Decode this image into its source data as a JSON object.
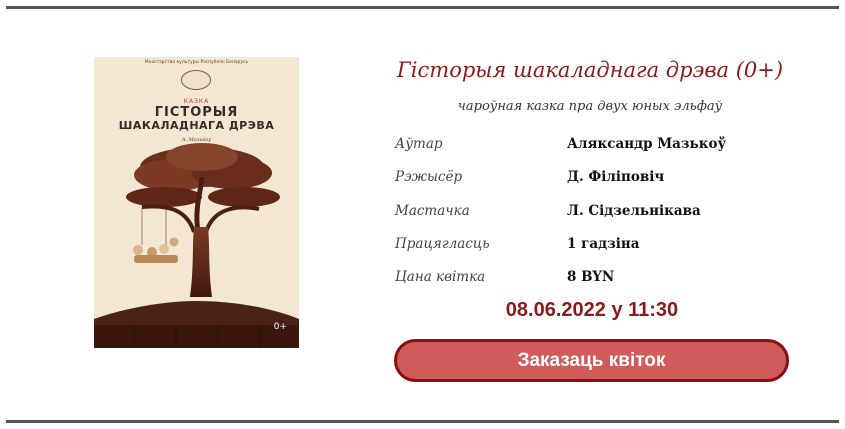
{
  "poster": {
    "ministry": "Міністэрства культуры Рэспублікі Беларусь",
    "genre": "КАЗКА",
    "title_line1": "ГІСТОРЫЯ",
    "title_line2": "ШАКАЛАДНАГА ДРЭВА",
    "author": "А. Мазькоў",
    "age": "0+"
  },
  "show": {
    "title": "Гісторыя шакаладнага дрэва (0+)",
    "subtitle": "чароўная казка пра двух юных эльфаў",
    "details": [
      {
        "label": "Аўтар",
        "value": "Аляксандр Мазькоў"
      },
      {
        "label": "Рэжысёр",
        "value": "Д. Філіповіч"
      },
      {
        "label": "Мастачка",
        "value": "Л. Сідзельнікава"
      },
      {
        "label": "Працягласць",
        "value": "1 гадзіна"
      },
      {
        "label": "Цана квіткa",
        "value": "8 BYN"
      }
    ],
    "datetime": "08.06.2022 у 11:30",
    "order_button": "Заказаць квіток"
  },
  "colors": {
    "accent": "#8b1b1b",
    "button_fill": "#cf5b5b",
    "button_border": "#8b0f0f",
    "poster_bg": "#f3e7d3",
    "rule": "#555555"
  }
}
